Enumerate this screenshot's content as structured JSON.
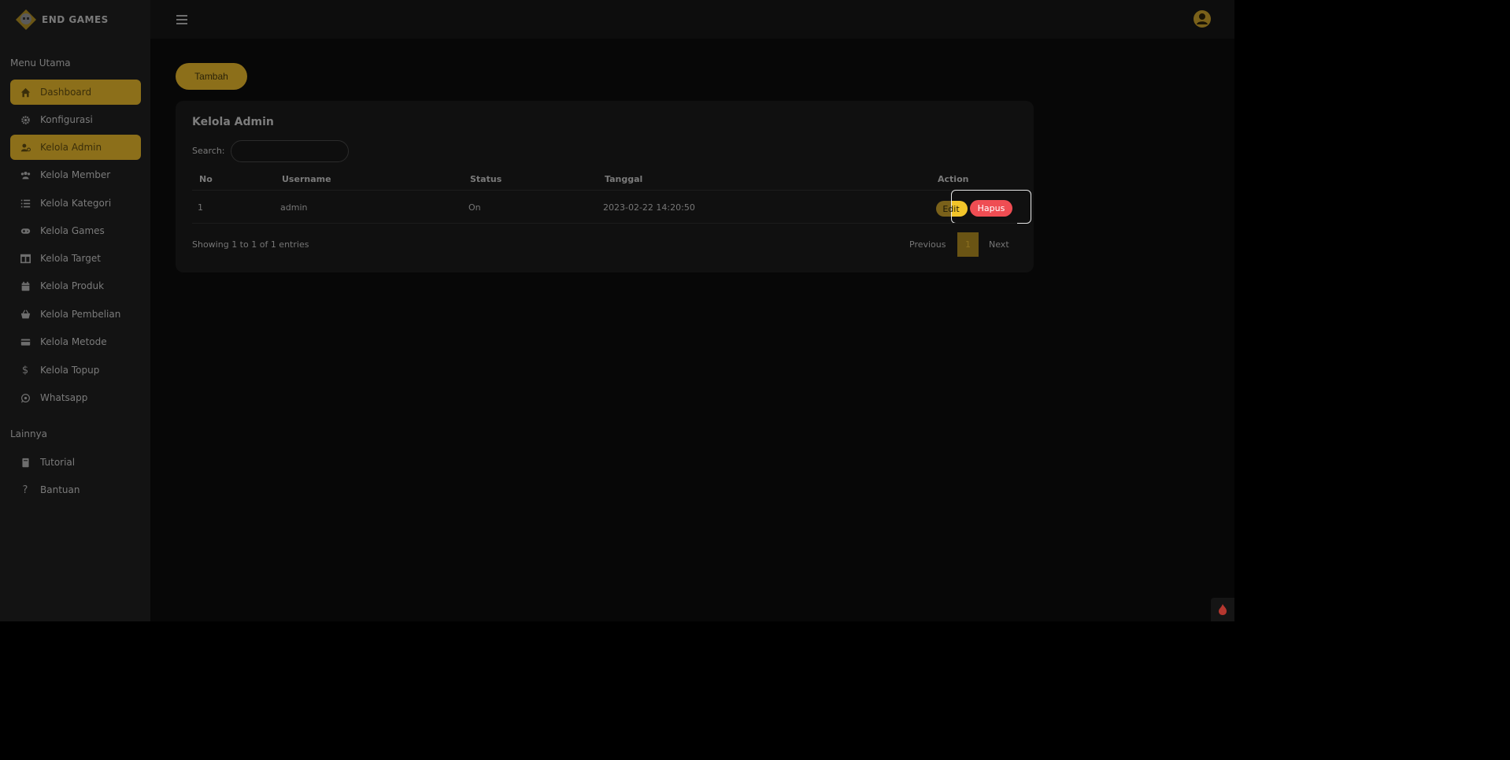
{
  "brand": {
    "name": "END GAMES"
  },
  "sidebar": {
    "section_main": "Menu Utama",
    "section_other": "Lainnya",
    "items": [
      {
        "label": "Dashboard",
        "icon": "home-icon",
        "active": true
      },
      {
        "label": "Konfigurasi",
        "icon": "gear-icon",
        "active": false
      },
      {
        "label": "Kelola Admin",
        "icon": "user-cog-icon",
        "active": true
      },
      {
        "label": "Kelola Member",
        "icon": "users-icon",
        "active": false
      },
      {
        "label": "Kelola Kategori",
        "icon": "list-icon",
        "active": false
      },
      {
        "label": "Kelola Games",
        "icon": "gamepad-icon",
        "active": false
      },
      {
        "label": "Kelola Target",
        "icon": "table-icon",
        "active": false
      },
      {
        "label": "Kelola Produk",
        "icon": "calendar-icon",
        "active": false
      },
      {
        "label": "Kelola Pembelian",
        "icon": "basket-icon",
        "active": false
      },
      {
        "label": "Kelola Metode",
        "icon": "credit-card-icon",
        "active": false
      },
      {
        "label": "Kelola Topup",
        "icon": "dollar-icon",
        "active": false
      },
      {
        "label": "Whatsapp",
        "icon": "whatsapp-icon",
        "active": false
      }
    ],
    "other_items": [
      {
        "label": "Tutorial",
        "icon": "book-icon"
      },
      {
        "label": "Bantuan",
        "icon": "question-icon"
      }
    ]
  },
  "main": {
    "add_button": "Tambah",
    "card_title": "Kelola Admin",
    "search_label": "Search:",
    "search_value": "",
    "columns": [
      "No",
      "Username",
      "Status",
      "Tanggal",
      "Action"
    ],
    "rows": [
      {
        "no": "1",
        "username": "admin",
        "status": "On",
        "tanggal": "2023-02-22 14:20:50"
      }
    ],
    "edit_label": "Edit",
    "delete_label": "Hapus",
    "showing": "Showing 1 to 1 of 1 entries",
    "pagination": {
      "previous": "Previous",
      "current": "1",
      "next": "Next"
    }
  },
  "colors": {
    "accent": "#8c6f1a",
    "danger": "#ef4d53",
    "highlight": "#f2c52a"
  }
}
